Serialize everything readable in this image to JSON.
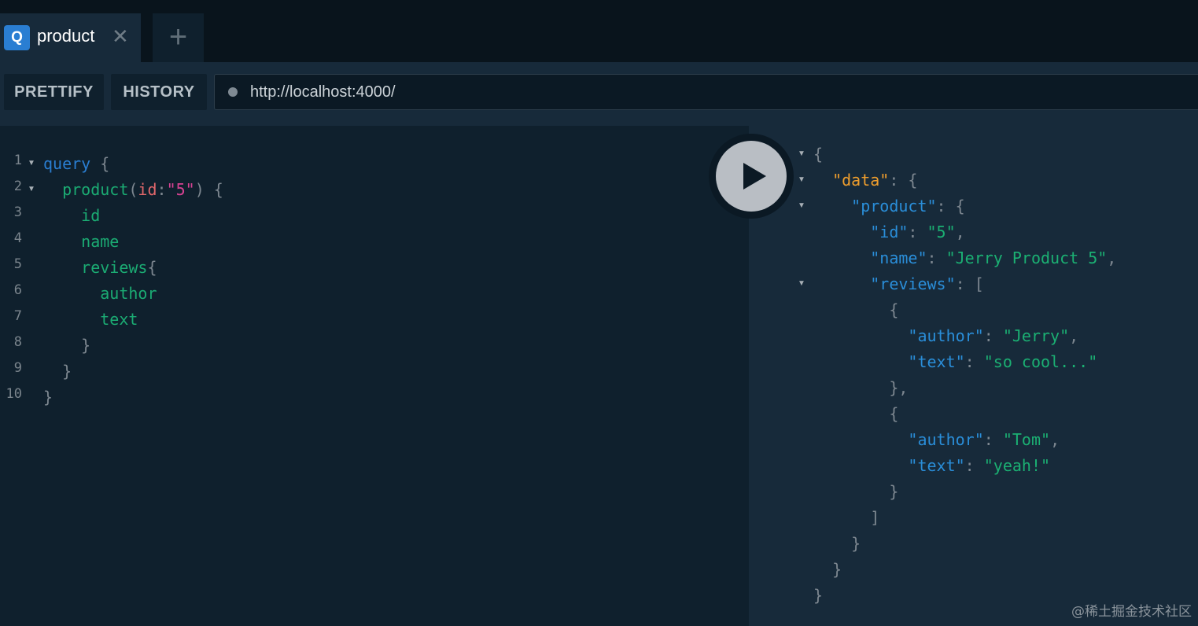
{
  "tabs": [
    {
      "badge": "Q",
      "title": "product",
      "close": "✕"
    }
  ],
  "new_tab_label": "+",
  "toolbar": {
    "prettify_label": "PRETTIFY",
    "history_label": "HISTORY",
    "endpoint": "http://localhost:4000/"
  },
  "query_lines": [
    {
      "num": "1",
      "fold": true,
      "tokens": [
        {
          "t": "kw",
          "v": "query"
        },
        {
          "t": "pun",
          "v": " {"
        }
      ]
    },
    {
      "num": "2",
      "fold": true,
      "tokens": [
        {
          "t": "fld",
          "v": "  product"
        },
        {
          "t": "pun",
          "v": "("
        },
        {
          "t": "arg",
          "v": "id"
        },
        {
          "t": "pun",
          "v": ":"
        },
        {
          "t": "str",
          "v": "\"5\""
        },
        {
          "t": "pun",
          "v": ") {"
        }
      ]
    },
    {
      "num": "3",
      "fold": false,
      "tokens": [
        {
          "t": "fld",
          "v": "    id"
        }
      ]
    },
    {
      "num": "4",
      "fold": false,
      "tokens": [
        {
          "t": "fld",
          "v": "    name"
        }
      ]
    },
    {
      "num": "5",
      "fold": false,
      "tokens": [
        {
          "t": "fld",
          "v": "    reviews"
        },
        {
          "t": "pun",
          "v": "{"
        }
      ]
    },
    {
      "num": "6",
      "fold": false,
      "tokens": [
        {
          "t": "fld",
          "v": "      author"
        }
      ]
    },
    {
      "num": "7",
      "fold": false,
      "tokens": [
        {
          "t": "fld",
          "v": "      text"
        }
      ]
    },
    {
      "num": "8",
      "fold": false,
      "tokens": [
        {
          "t": "pun",
          "v": "    }"
        }
      ]
    },
    {
      "num": "9",
      "fold": false,
      "tokens": [
        {
          "t": "pun",
          "v": "  }"
        }
      ]
    },
    {
      "num": "10",
      "fold": false,
      "tokens": [
        {
          "t": "pun",
          "v": "}"
        }
      ]
    }
  ],
  "result_lines": [
    {
      "fold": true,
      "tokens": [
        {
          "t": "rpun",
          "v": "{"
        }
      ]
    },
    {
      "fold": true,
      "tokens": [
        {
          "t": "rkey-data",
          "v": "  \"data\""
        },
        {
          "t": "rpun",
          "v": ": {"
        }
      ]
    },
    {
      "fold": true,
      "tokens": [
        {
          "t": "rkey",
          "v": "    \"product\""
        },
        {
          "t": "rpun",
          "v": ": {"
        }
      ]
    },
    {
      "fold": false,
      "tokens": [
        {
          "t": "rkey",
          "v": "      \"id\""
        },
        {
          "t": "rpun",
          "v": ": "
        },
        {
          "t": "rstr",
          "v": "\"5\""
        },
        {
          "t": "rpun",
          "v": ","
        }
      ]
    },
    {
      "fold": false,
      "tokens": [
        {
          "t": "rkey",
          "v": "      \"name\""
        },
        {
          "t": "rpun",
          "v": ": "
        },
        {
          "t": "rstr",
          "v": "\"Jerry Product 5\""
        },
        {
          "t": "rpun",
          "v": ","
        }
      ]
    },
    {
      "fold": true,
      "tokens": [
        {
          "t": "rkey",
          "v": "      \"reviews\""
        },
        {
          "t": "rpun",
          "v": ": ["
        }
      ]
    },
    {
      "fold": false,
      "tokens": [
        {
          "t": "rpun",
          "v": "        {"
        }
      ]
    },
    {
      "fold": false,
      "tokens": [
        {
          "t": "rkey",
          "v": "          \"author\""
        },
        {
          "t": "rpun",
          "v": ": "
        },
        {
          "t": "rstr",
          "v": "\"Jerry\""
        },
        {
          "t": "rpun",
          "v": ","
        }
      ]
    },
    {
      "fold": false,
      "tokens": [
        {
          "t": "rkey",
          "v": "          \"text\""
        },
        {
          "t": "rpun",
          "v": ": "
        },
        {
          "t": "rstr",
          "v": "\"so cool...\""
        }
      ]
    },
    {
      "fold": false,
      "tokens": [
        {
          "t": "rpun",
          "v": "        },"
        }
      ]
    },
    {
      "fold": false,
      "tokens": [
        {
          "t": "rpun",
          "v": "        {"
        }
      ]
    },
    {
      "fold": false,
      "tokens": [
        {
          "t": "rkey",
          "v": "          \"author\""
        },
        {
          "t": "rpun",
          "v": ": "
        },
        {
          "t": "rstr",
          "v": "\"Tom\""
        },
        {
          "t": "rpun",
          "v": ","
        }
      ]
    },
    {
      "fold": false,
      "tokens": [
        {
          "t": "rkey",
          "v": "          \"text\""
        },
        {
          "t": "rpun",
          "v": ": "
        },
        {
          "t": "rstr",
          "v": "\"yeah!\""
        }
      ]
    },
    {
      "fold": false,
      "tokens": [
        {
          "t": "rpun",
          "v": "        }"
        }
      ]
    },
    {
      "fold": false,
      "tokens": [
        {
          "t": "rpun",
          "v": "      ]"
        }
      ]
    },
    {
      "fold": false,
      "tokens": [
        {
          "t": "rpun",
          "v": "    }"
        }
      ]
    },
    {
      "fold": false,
      "tokens": [
        {
          "t": "rpun",
          "v": "  }"
        }
      ]
    },
    {
      "fold": false,
      "tokens": [
        {
          "t": "rpun",
          "v": "}"
        }
      ]
    }
  ],
  "play_icon": "play-icon",
  "watermark": "@稀土掘金技术社区",
  "colors": {
    "accent": "#2a7ed2",
    "field": "#1bab73",
    "data_key": "#ef9e2d",
    "string_arg": "#d64292"
  }
}
